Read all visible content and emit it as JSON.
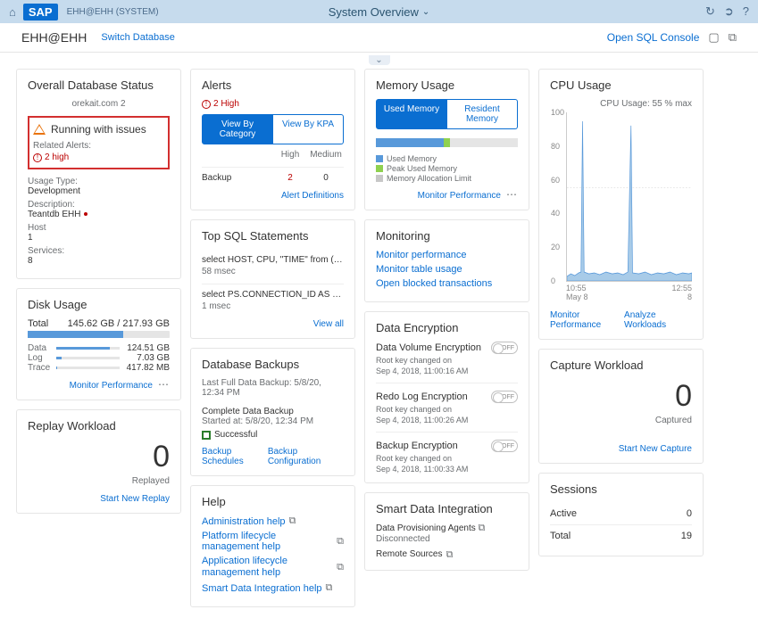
{
  "topbar": {
    "system": "EHH@EHH (SYSTEM)",
    "title": "System Overview"
  },
  "subheader": {
    "db": "EHH@EHH",
    "switch": "Switch Database",
    "open_sql": "Open SQL Console"
  },
  "status": {
    "title": "Overall Database Status",
    "subtitle": "orekait.com 2",
    "running": "Running with issues",
    "related": "Related Alerts:",
    "high": "2 high",
    "usage_label": "Usage Type:",
    "usage_val": "Development",
    "desc_label": "Description:",
    "desc_val": "Teantdb EHH",
    "host_label": "Host",
    "host_val": "1",
    "svc_label": "Services:",
    "svc_val": "8"
  },
  "disk": {
    "title": "Disk Usage",
    "total_label": "Total",
    "total_val": "145.62 GB / 217.93 GB",
    "data_label": "Data",
    "data_val": "124.51 GB",
    "log_label": "Log",
    "log_val": "7.03 GB",
    "trace_label": "Trace",
    "trace_val": "417.82 MB",
    "monitor": "Monitor Performance"
  },
  "replay": {
    "title": "Replay Workload",
    "num": "0",
    "label": "Replayed",
    "link": "Start New Replay"
  },
  "alerts": {
    "title": "Alerts",
    "high": "2 High",
    "seg1": "View By Category",
    "seg2": "View By KPA",
    "col_high": "High",
    "col_med": "Medium",
    "row_label": "Backup",
    "row_high": "2",
    "row_med": "0",
    "defs": "Alert Definitions"
  },
  "sql": {
    "title": "Top SQL Statements",
    "q1": "select HOST, CPU, \"TIME\" from ( select HOST, ...",
    "t1": "58 msec",
    "q2": "select PS.CONNECTION_ID AS \"Connection ID...",
    "t2": "1 msec",
    "viewall": "View all"
  },
  "backup": {
    "title": "Database Backups",
    "last": "Last Full Data Backup: 5/8/20, 12:34 PM",
    "complete": "Complete Data Backup",
    "started": "Started at: 5/8/20, 12:34 PM",
    "success": "Successful",
    "sched": "Backup Schedules",
    "conf": "Backup Configuration"
  },
  "help": {
    "title": "Help",
    "h1": "Administration help",
    "h2": "Platform lifecycle management help",
    "h3": "Application lifecycle management help",
    "h4": "Smart Data Integration help"
  },
  "mem": {
    "title": "Memory Usage",
    "seg1": "Used Memory",
    "seg2": "Resident Memory",
    "l1": "Used Memory",
    "l2": "Peak Used Memory",
    "l3": "Memory Allocation Limit",
    "monitor": "Monitor Performance"
  },
  "monitoring": {
    "title": "Monitoring",
    "l1": "Monitor performance",
    "l2": "Monitor table usage",
    "l3": "Open blocked transactions"
  },
  "enc": {
    "title": "Data Encryption",
    "dv_title": "Data Volume Encryption",
    "dv_sub1": "Root key changed on",
    "dv_sub2": "Sep 4, 2018, 11:00:16 AM",
    "rl_title": "Redo Log Encryption",
    "rl_sub1": "Root key changed on",
    "rl_sub2": "Sep 4, 2018, 11:00:26 AM",
    "bk_title": "Backup Encryption",
    "bk_sub1": "Root key changed on",
    "bk_sub2": "Sep 4, 2018, 11:00:33 AM",
    "off": "OFF"
  },
  "sdi": {
    "title": "Smart Data Integration",
    "l1a": "Data Provisioning Agents",
    "l1b": "Disconnected",
    "l2a": "Remote Sources"
  },
  "cpu": {
    "title": "CPU Usage",
    "label": "CPU Usage: 55 % max",
    "x1a": "10:55",
    "x1b": "May 8",
    "x2a": "12:55",
    "x2b": "8",
    "l1": "Monitor Performance",
    "l2": "Analyze Workloads"
  },
  "capture": {
    "title": "Capture Workload",
    "num": "0",
    "label": "Captured",
    "link": "Start New Capture"
  },
  "sessions": {
    "title": "Sessions",
    "r1l": "Active",
    "r1v": "0",
    "r2l": "Total",
    "r2v": "19"
  },
  "chart_data": {
    "type": "line",
    "title": "CPU Usage",
    "ylabel": "CPU Usage %",
    "ylim": [
      0,
      100
    ],
    "x_range": [
      "10:55 May 8",
      "12:55 May 8"
    ],
    "notes": "Area chart, mostly low (~3-8%) with two spikes near 100%",
    "approx_points": [
      5,
      7,
      4,
      6,
      8,
      5,
      98,
      6,
      5,
      7,
      4,
      6,
      5,
      7,
      6,
      95,
      5,
      7,
      6,
      4,
      8,
      5,
      7,
      6,
      4,
      5,
      6,
      7,
      5,
      4
    ]
  }
}
